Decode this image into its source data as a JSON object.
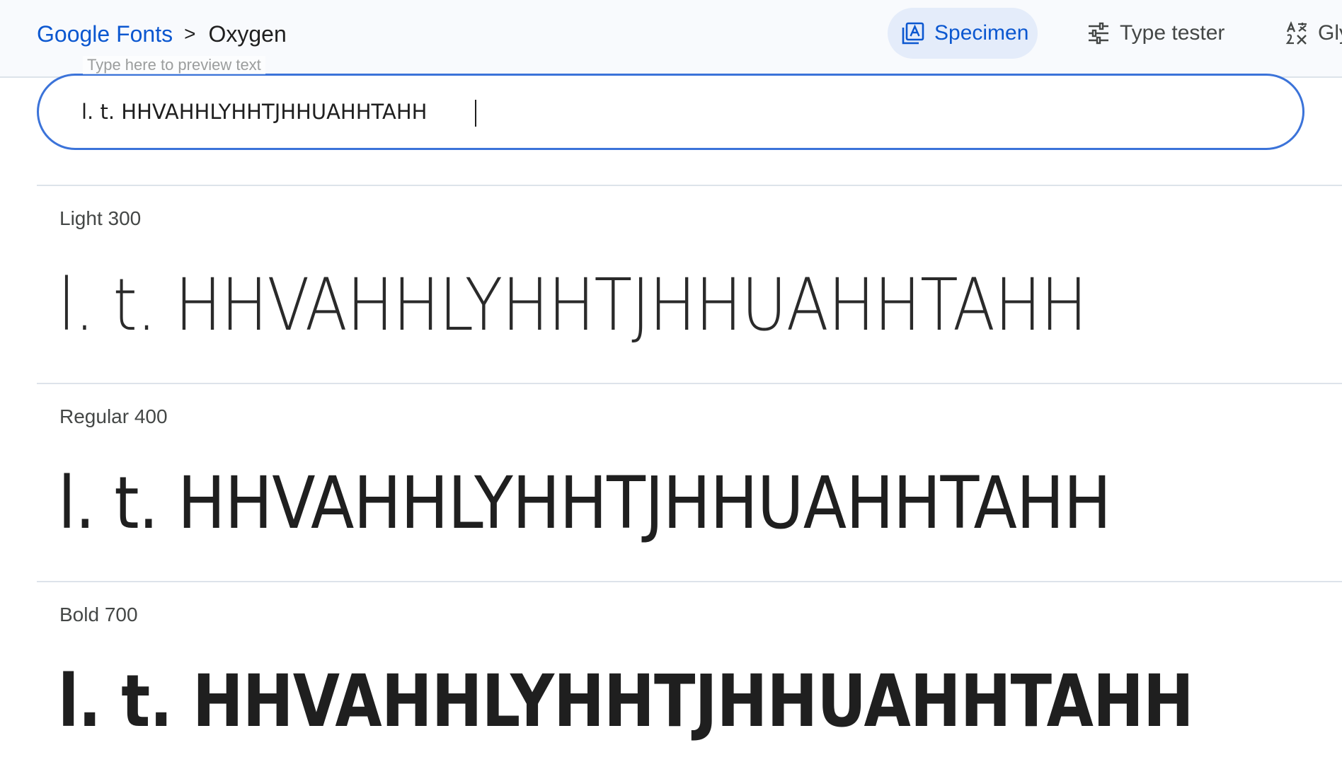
{
  "breadcrumb": {
    "root": "Google Fonts",
    "separator": ">",
    "current": "Oxygen"
  },
  "tabs": [
    {
      "label": "Specimen",
      "icon": "specimen-icon",
      "active": true
    },
    {
      "label": "Type tester",
      "icon": "sliders-icon",
      "active": false
    },
    {
      "label": "Gly",
      "icon": "glyphs-icon",
      "active": false
    }
  ],
  "tester": {
    "label": "Type here to preview text",
    "value": "l. t. HHVAHHLYHHTJHHUAHHTAHH"
  },
  "styles": [
    {
      "name": "Light 300",
      "preview": "l. t. HHVAHHLYHHTJHHUAHHTAHH"
    },
    {
      "name": "Regular 400",
      "preview": "l. t. HHVAHHLYHHTJHHUAHHTAHH"
    },
    {
      "name": "Bold 700",
      "preview": "l. t. HHVAHHLYHHTJHHUAHHTAHH"
    }
  ],
  "colors": {
    "accent": "#0b57d0",
    "active_tab_bg": "#e4ecfa",
    "input_border": "#3b73d9",
    "divider": "#dde3ea"
  }
}
